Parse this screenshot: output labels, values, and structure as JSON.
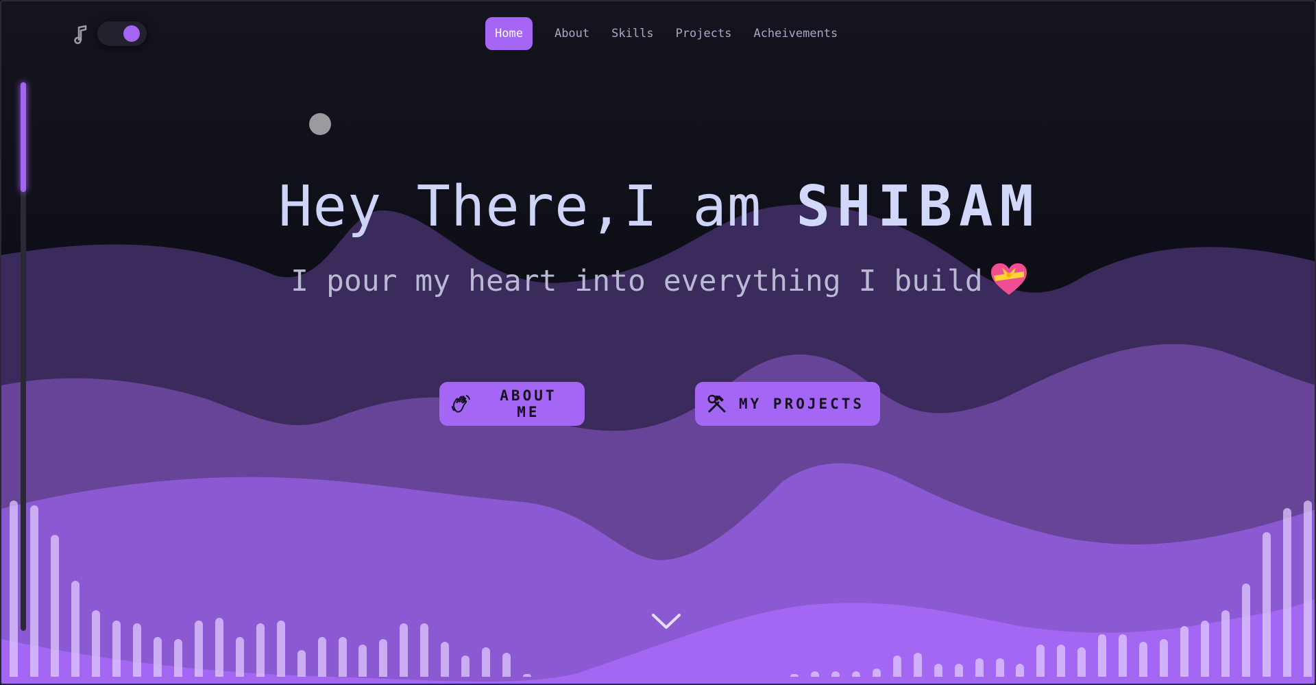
{
  "nav": {
    "items": [
      {
        "label": "Home",
        "active": true
      },
      {
        "label": "About",
        "active": false
      },
      {
        "label": "Skills",
        "active": false
      },
      {
        "label": "Projects",
        "active": false
      },
      {
        "label": "Acheivements",
        "active": false
      }
    ]
  },
  "controls": {
    "music_icon": "music-note-icon",
    "sound_toggle_on": true
  },
  "hero": {
    "greeting": "Hey There,I am ",
    "name": "SHIBAM",
    "tagline": "I pour my heart into everything I build",
    "tagline_icon": "heart-with-ribbon-icon"
  },
  "buttons": {
    "about": {
      "label": "ABOUT ME",
      "icon": "waving-hand-icon"
    },
    "projects": {
      "label": "MY PROJECTS",
      "icon": "hammer-wrench-icon"
    }
  },
  "scroll_indicator": "chevron-down-icon",
  "colors": {
    "accent": "#a566f5",
    "background": "#0d0e18",
    "wave_dark": "#3b2a5c",
    "wave_mid": "#6a47a6",
    "wave_light": "#8c5cd4",
    "wave_front": "#a567f6",
    "text": "#cdd4f8"
  },
  "visualizer": {
    "levels": [
      0.66,
      0.64,
      0.53,
      0.36,
      0.25,
      0.21,
      0.2,
      0.15,
      0.14,
      0.21,
      0.22,
      0.15,
      0.2,
      0.21,
      0.1,
      0.15,
      0.15,
      0.12,
      0.14,
      0.2,
      0.2,
      0.13,
      0.08,
      0.11,
      0.09,
      0.01,
      0,
      0,
      0,
      0,
      0,
      0,
      0,
      0,
      0,
      0,
      0,
      0,
      0.01,
      0.02,
      0.02,
      0.02,
      0.03,
      0.08,
      0.09,
      0.05,
      0.05,
      0.07,
      0.07,
      0.05,
      0.12,
      0.12,
      0.11,
      0.16,
      0.16,
      0.13,
      0.14,
      0.19,
      0.21,
      0.25,
      0.35,
      0.54,
      0.63,
      0.66
    ]
  }
}
